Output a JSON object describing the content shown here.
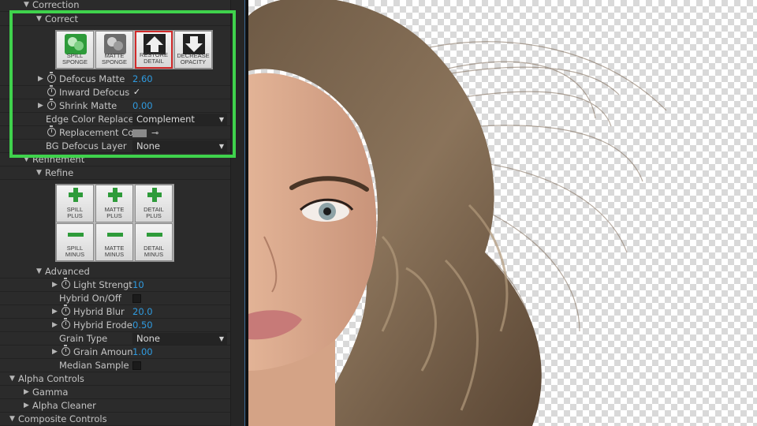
{
  "sections": {
    "correction": "Correction",
    "correct": "Correct",
    "refinement": "Refinement",
    "refine": "Refine",
    "advanced": "Advanced",
    "alpha_controls": "Alpha Controls",
    "gamma": "Gamma",
    "alpha_cleaner": "Alpha Cleaner",
    "composite_controls": "Composite Controls"
  },
  "correct_buttons": [
    {
      "line1": "SPILL",
      "line2": "SPONGE"
    },
    {
      "line1": "MATTE",
      "line2": "SPONGE"
    },
    {
      "line1": "RESTORE",
      "line2": "DETAIL"
    },
    {
      "line1": "DECREASE",
      "line2": "OPACITY"
    }
  ],
  "correct_params": {
    "defocus_matte": {
      "label": "Defocus Matte",
      "value": "2.60"
    },
    "inward_defocus": {
      "label": "Inward Defocus",
      "value": "✓"
    },
    "shrink_matte": {
      "label": "Shrink Matte",
      "value": "0.00"
    },
    "edge_color_replace": {
      "label": "Edge Color Replace",
      "value": "Complement"
    },
    "replacement_color": {
      "label": "Replacement Co",
      "swatch": "#8a8a8a"
    },
    "bg_defocus_layer": {
      "label": "BG Defocus Layer",
      "value": "None"
    }
  },
  "refine_buttons": [
    {
      "line1": "SPILL",
      "line2": "PLUS"
    },
    {
      "line1": "MATTE",
      "line2": "PLUS"
    },
    {
      "line1": "DETAIL",
      "line2": "PLUS"
    },
    {
      "line1": "SPILL",
      "line2": "MINUS"
    },
    {
      "line1": "MATTE",
      "line2": "MINUS"
    },
    {
      "line1": "DETAIL",
      "line2": "MINUS"
    }
  ],
  "advanced_params": {
    "light_strength": {
      "label": "Light Strengt",
      "value": "10"
    },
    "hybrid_onoff": {
      "label": "Hybrid On/Off"
    },
    "hybrid_blur": {
      "label": "Hybrid Blur",
      "value": "20.0"
    },
    "hybrid_erode": {
      "label": "Hybrid Erode",
      "value": "0.50"
    },
    "grain_type": {
      "label": "Grain Type",
      "value": "None"
    },
    "grain_amount": {
      "label": "Grain Amoun",
      "value": "1.00"
    },
    "median_sample": {
      "label": "Median Sample"
    }
  },
  "colors": {
    "highlight": "#3fd24c",
    "value_blue": "#2f9be0",
    "button_green": "#2e9b3a",
    "restore_outline": "#d22b2b"
  }
}
